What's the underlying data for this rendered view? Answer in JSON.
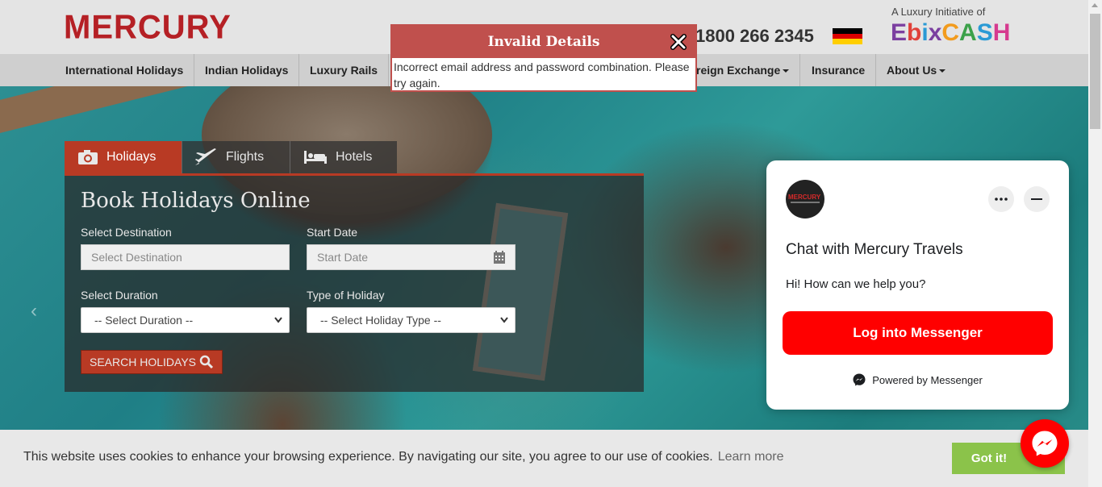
{
  "header": {
    "logo": "MERCURY",
    "phone": "1800 266 2345",
    "ebix_tagline": "A Luxury Initiative of",
    "ebix_letters": [
      "E",
      "b",
      "i",
      "x",
      "C",
      "A",
      "S",
      "H"
    ],
    "flag_colors": [
      "#000000",
      "#dd0000",
      "#ffce00"
    ]
  },
  "nav": {
    "items": [
      {
        "label": "International Holidays"
      },
      {
        "label": "Indian Holidays"
      },
      {
        "label": "Luxury Rails"
      },
      {
        "label": "reign Exchange"
      },
      {
        "label": "Insurance"
      },
      {
        "label": "About Us"
      }
    ]
  },
  "booking": {
    "tabs": [
      {
        "label": "Holidays",
        "icon": "camera-icon",
        "active": true
      },
      {
        "label": "Flights",
        "icon": "plane-icon",
        "active": false
      },
      {
        "label": "Hotels",
        "icon": "bed-icon",
        "active": false
      }
    ],
    "title": "Book Holidays Online",
    "destination_label": "Select Destination",
    "destination_placeholder": "Select Destination",
    "start_date_label": "Start Date",
    "start_date_placeholder": "Start Date",
    "duration_label": "Select Duration",
    "duration_value": "-- Select Duration --",
    "holiday_type_label": "Type of Holiday",
    "holiday_type_value": "-- Select Holiday Type --",
    "search_button": "SEARCH HOLIDAYS"
  },
  "modal": {
    "title": "Invalid Details",
    "message": "Incorrect email address and password combination. Please try again."
  },
  "chat": {
    "avatar_text": "MERCURY",
    "title": "Chat with Mercury Travels",
    "greeting": "Hi! How can we help you?",
    "login_button": "Log into Messenger",
    "powered_by": "Powered by Messenger"
  },
  "cookie": {
    "message": "This website uses cookies to enhance your browsing experience. By navigating our site, you agree to our use of cookies.",
    "learn_more": "Learn more",
    "accept_button": "Got it!"
  },
  "colors": {
    "brand_red": "#b52025",
    "accent_red": "#b83a24",
    "modal_red": "#c0504d",
    "messenger_red": "#ff0000",
    "cookie_green": "#8bc34a"
  }
}
